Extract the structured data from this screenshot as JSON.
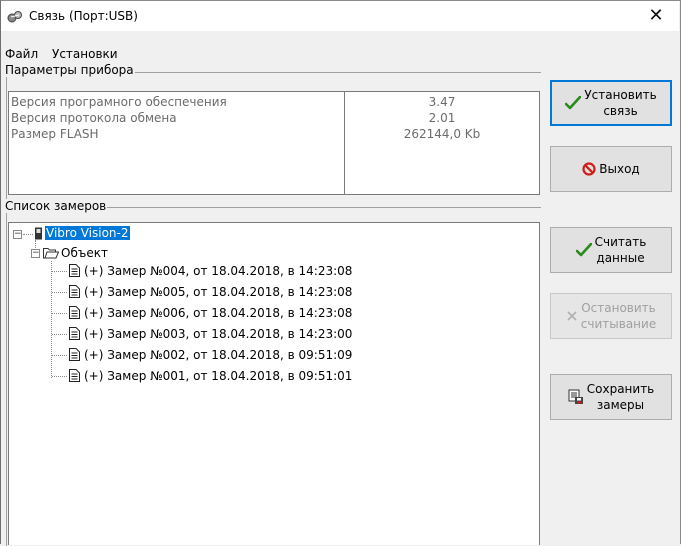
{
  "window": {
    "title": "Связь (Порт:USB)",
    "close_glyph": "✕"
  },
  "menu": [
    "Файл",
    "Установки"
  ],
  "params_group": {
    "label": "Параметры прибора",
    "rows": [
      {
        "name": "Версия програмного обеспечения",
        "value": "3.47"
      },
      {
        "name": "Версия протокола обмена",
        "value": "2.01"
      },
      {
        "name": "Размер FLASH",
        "value": "262144,0 Kb"
      }
    ]
  },
  "list_group": {
    "label": "Список замеров",
    "device": "Vibro Vision-2",
    "object": "Объект",
    "items": [
      "(+) Замер №004, от 18.04.2018, в 14:23:08",
      "(+) Замер №005, от 18.04.2018, в 14:23:08",
      "(+) Замер №006, от 18.04.2018, в 14:23:08",
      "(+) Замер №003, от 18.04.2018, в 14:23:00",
      "(+) Замер №002, от 18.04.2018, в 09:51:09",
      "(+) Замер №001, от 18.04.2018, в 09:51:01"
    ]
  },
  "buttons": {
    "connect": "Установить\nсвязь",
    "exit": "Выход",
    "read": "Считать\nданные",
    "stop": "Остановить\nсчитывание",
    "save": "Сохранить\nзамеры"
  },
  "icons": {
    "check": "check-icon",
    "stop": "no-entry-icon",
    "stop_x": "x-icon",
    "save": "save-icon",
    "folder": "folder-icon",
    "file": "document-icon",
    "device": "device-icon"
  },
  "colors": {
    "selection": "#0078d7",
    "check": "#2a8a1e",
    "exit_icon": "#d11b1b"
  }
}
